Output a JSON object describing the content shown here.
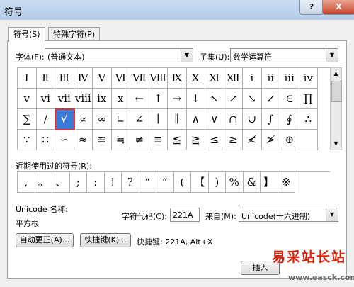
{
  "window": {
    "title": "符号",
    "help": "?",
    "close": "X"
  },
  "tabs": [
    {
      "label": "符号(S)"
    },
    {
      "label": "特殊字符(P)"
    }
  ],
  "font": {
    "label": "字体(F):",
    "value": "(普通文本)"
  },
  "subset": {
    "label": "子集(U):",
    "value": "数学运算符"
  },
  "symbols": [
    [
      "Ⅰ",
      "Ⅱ",
      "Ⅲ",
      "Ⅳ",
      "Ⅴ",
      "Ⅵ",
      "Ⅶ",
      "Ⅷ",
      "Ⅸ",
      "Ⅹ",
      "Ⅺ",
      "Ⅻ",
      "ⅰ",
      "ⅱ",
      "ⅲ",
      "ⅳ"
    ],
    [
      "ⅴ",
      "ⅵ",
      "ⅶ",
      "ⅷ",
      "ⅸ",
      "ⅹ",
      "←",
      "↑",
      "→",
      "↓",
      "↖",
      "↗",
      "↘",
      "↙",
      "∈",
      "∏"
    ],
    [
      "∑",
      "∕",
      "√",
      "∝",
      "∞",
      "∟",
      "∠",
      "∣",
      "∥",
      "∧",
      "∨",
      "∩",
      "∪",
      "∫",
      "∮",
      "∴"
    ],
    [
      "∵",
      "∷",
      "∽",
      "≈",
      "≌",
      "≒",
      "≠",
      "≡",
      "≦",
      "≧",
      "≤",
      "≥",
      "≮",
      "≯",
      "⊕",
      ""
    ]
  ],
  "selected_symbol": "√",
  "recent": {
    "label": "近期使用过的符号(R):",
    "symbols": [
      ",",
      "。",
      "、",
      ";",
      ":",
      "!",
      "?",
      "“",
      "”",
      "(",
      "【",
      ")",
      "%",
      "&",
      "】",
      "※"
    ]
  },
  "unicode": {
    "name_label": "Unicode 名称:",
    "name": "平方根"
  },
  "char_code": {
    "label": "字符代码(C):",
    "value": "221A"
  },
  "from": {
    "label": "来自(M):",
    "value": "Unicode(十六进制)"
  },
  "buttons": {
    "autocorrect": "自动更正(A)...",
    "shortcut_key": "快捷键(K)...",
    "insert": "插入"
  },
  "shortcut": {
    "text": "快捷键: 221A, Alt+X"
  },
  "watermark": {
    "cn": "易采站长站",
    "url": "www.easck.com"
  }
}
